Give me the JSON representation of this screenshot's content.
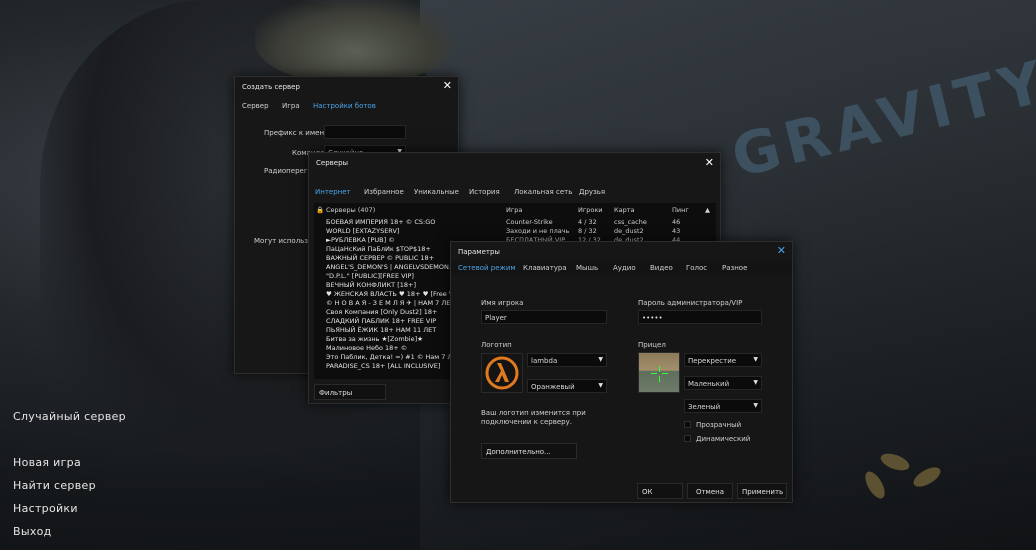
{
  "background": {
    "watermark": "GRAVITY"
  },
  "main_menu": {
    "items": [
      "Случайный сервер",
      "Новая игра",
      "Найти сервер",
      "Настройки",
      "Выход"
    ]
  },
  "create_server": {
    "title": "Создать сервер",
    "tabs": [
      "Сервер",
      "Игра",
      "Настройки ботов"
    ],
    "active_tab": "Настройки ботов",
    "fields": {
      "prefix_label": "Префикс к имени",
      "team_label": "Команда",
      "team_value": "Случайно",
      "radio_label": "Радиоперегов",
      "can_use_label": "Могут использов"
    }
  },
  "servers": {
    "title": "Серверы",
    "tabs": [
      "Интернет",
      "Избранное",
      "Уникальные",
      "История",
      "Локальная сеть",
      "Друзья"
    ],
    "active_tab": "Интернет",
    "columns": {
      "servers": "Серверы (407)",
      "game": "Игра",
      "players": "Игроки",
      "map": "Карта",
      "ping": "Пинг"
    },
    "rows": [
      {
        "name": "БОЕВАЯ ИМПЕРИЯ 18+ © CS:GO",
        "game": "Counter-Strike",
        "players": "4 / 32",
        "map": "css_cache",
        "ping": "46"
      },
      {
        "name": "WORLD [EXTAZYSERV]",
        "game": "Заходи и не плачь",
        "players": "8 / 32",
        "map": "de_dust2",
        "ping": "43"
      },
      {
        "name": "►РУБЛЕВКА [PUB] ©",
        "game": "БЕСПЛАТНЫЙ VIP",
        "players": "12 / 32",
        "map": "de_dust2",
        "ping": "44"
      },
      {
        "name": "ПаЦаНсКий ПаБлИк $TOP$18+"
      },
      {
        "name": "ВАЖНЫЙ СЕРВЕР © PUBLIC 18+"
      },
      {
        "name": "ANGEL'S_DEMON'S | ANGELVSDEMON.RU"
      },
      {
        "name": "\"D.P.L.\" [PUBLIC][FREE VIP]"
      },
      {
        "name": "ВЕЧНЫЙ КОНФЛИКТ [18+]"
      },
      {
        "name": "♥ ЖЕНСКАЯ ВЛАСТЬ ♥ 18+ ♥ [Free VIP]"
      },
      {
        "name": "© Н О В А Я - З Е М Л Я ✈ | НАМ 7 ЛЕТ"
      },
      {
        "name": "Своя Компания [Only Dust2] 18+"
      },
      {
        "name": "СЛАДКИЙ ПАБЛИК 18+ FREE VIP"
      },
      {
        "name": "ПЬЯНЫЙ ЁЖИК 18+ НАМ 11 ЛЕТ"
      },
      {
        "name": "Битва за жизнь ★[Zombie]★"
      },
      {
        "name": "Малиновое Небо 18+ ©"
      },
      {
        "name": "Это Паблик, Детка! =) #1 © Нам 7 ЛЕТ"
      },
      {
        "name": "PARADISE_CS 18+ [ALL INCLUSIVE]"
      }
    ],
    "filters_button": "Фильтры"
  },
  "options": {
    "title": "Параметры",
    "tabs": [
      "Сетевой режим",
      "Клавиатура",
      "Мышь",
      "Аудио",
      "Видео",
      "Голос",
      "Разное"
    ],
    "active_tab": "Сетевой режим",
    "player_name_label": "Имя игрока",
    "player_name_value": "Player",
    "admin_password_label": "Пароль администратора/VIP",
    "admin_password_value": "•••••",
    "logo_label": "Логотип",
    "logo_value": "lambda",
    "logo_color": "Оранжевый",
    "crosshair_label": "Прицел",
    "crosshair_type": "Перекрестие",
    "crosshair_size": "Маленький",
    "crosshair_color": "Зеленый",
    "transparent_label": "Прозрачный",
    "dynamic_label": "Динамический",
    "logo_note": "Ваш логотип изменится при подключении к серверу.",
    "advanced_button": "Дополнительно...",
    "ok_button": "ОК",
    "cancel_button": "Отмена",
    "apply_button": "Применить",
    "colors": {
      "accent": "#4aa3e6",
      "logo_orange": "#e07a1f"
    }
  }
}
